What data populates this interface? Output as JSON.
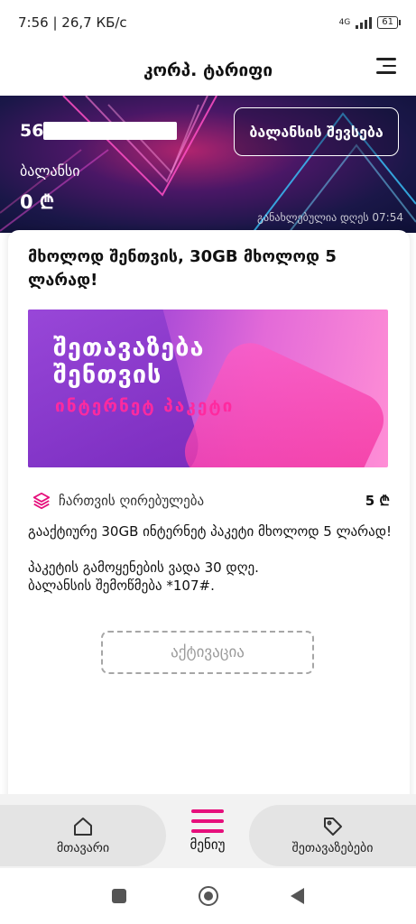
{
  "status_bar": {
    "time_speed": "7:56 | 26,7 КБ/с",
    "network": "4G",
    "battery": "61"
  },
  "header": {
    "title": "კორპ. ტარიფი"
  },
  "hero": {
    "phone_prefix": "56",
    "topup_label": "ბალანსის შევსება",
    "balance_label": "ბალანსი",
    "balance_value": "0 ₾",
    "updated": "განახლებულია დღეს 07:54"
  },
  "offer": {
    "title": "მხოლოდ შენთვის, 30GB მხოლოდ 5 ლარად!",
    "banner_line1": "შეთავაზება",
    "banner_line2": "შენთვის",
    "banner_line3": "ინტერნეტ პაკეტი",
    "fee_label": "ჩართვის ღირებულება",
    "fee_value": "5 ₾",
    "desc_line1": "გააქტიურე 30GB ინტერნეტ პაკეტი მხოლოდ 5 ლარად!",
    "desc_line2": "პაკეტის გამოყენების ვადა 30 დღე.",
    "desc_line3": "ბალანსის შემოწმება *107#.",
    "activate_label": "აქტივაცია"
  },
  "bottom_nav": {
    "home_label": "მთავარი",
    "menu_label": "მენიუ",
    "offers_label": "შეთავაზებები"
  },
  "colors": {
    "accent": "#e6107c",
    "hero_dark": "#1a1748"
  }
}
